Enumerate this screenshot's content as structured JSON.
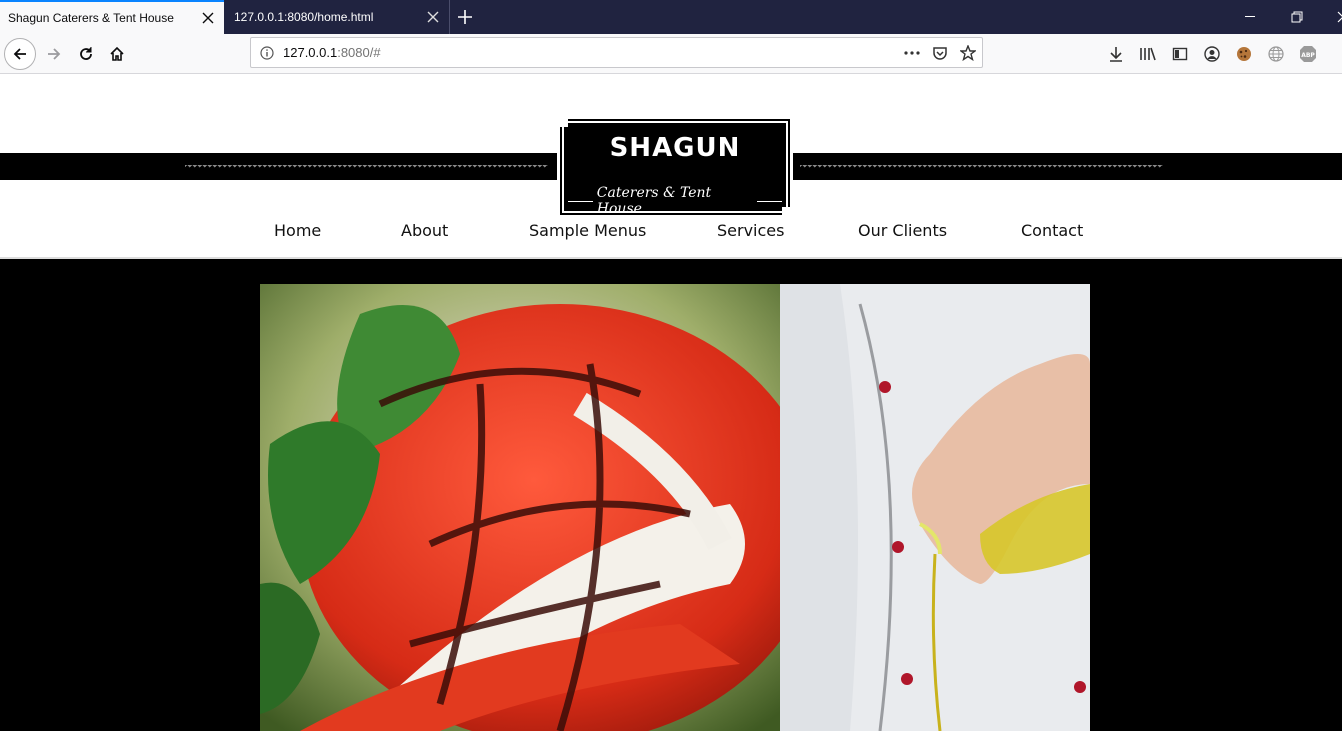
{
  "browser": {
    "tabs": [
      {
        "title": "Shagun Caterers & Tent House",
        "active": true
      },
      {
        "title": "127.0.0.1:8080/home.html",
        "active": false
      }
    ],
    "url": {
      "host": "127.0.0.1",
      "rest": ":8080/#"
    },
    "toolbar_icons": [
      "download-icon",
      "library-icon",
      "sidebar-icon",
      "account-icon",
      "cookie-icon",
      "globe-icon",
      "adblock-icon"
    ]
  },
  "site": {
    "logo": {
      "title": "SHAGUN",
      "subtitle": "Caterers & Tent House"
    },
    "menu": [
      "Home",
      "About",
      "Sample Menus",
      "Services",
      "Our Clients",
      "Contact"
    ]
  },
  "colors": {
    "chrome_dark": "#202340",
    "accent": "#0a84ff",
    "band": "#000000"
  }
}
